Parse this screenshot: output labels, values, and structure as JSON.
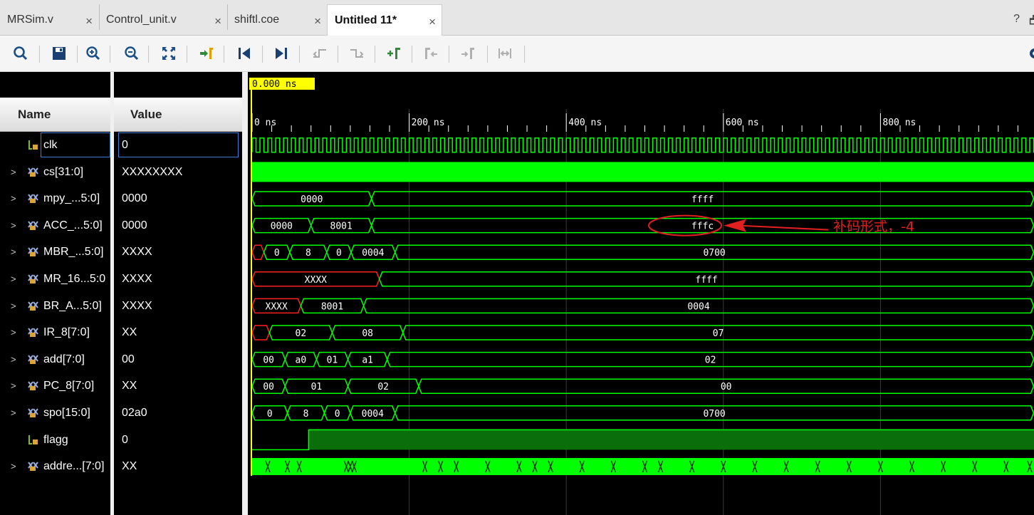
{
  "tabs": [
    {
      "label": "MRSim.v",
      "close": "×"
    },
    {
      "label": "Control_unit.v",
      "close": "×"
    },
    {
      "label": "shiftl.coe",
      "close": "×"
    },
    {
      "label": "Untitled 11*",
      "close": "×"
    }
  ],
  "window_controls": {
    "help": "?",
    "restore": "🗗"
  },
  "toolbar_icons": [
    "search-icon",
    "save-icon",
    "zoom-in-icon",
    "zoom-out-icon",
    "zoom-fit-icon",
    "go-to-cursor-icon",
    "go-to-time-zero-icon",
    "go-to-last-time-icon",
    "previous-transition-icon",
    "next-transition-icon",
    "add-marker-icon",
    "previous-marker-icon",
    "next-marker-icon",
    "swap-cursors-icon",
    "settings-icon"
  ],
  "headers": {
    "name": "Name",
    "value": "Value"
  },
  "cursor_time": "0.000 ns",
  "signals": [
    {
      "name": "clk",
      "value": "0",
      "type": "bit",
      "expandable": false
    },
    {
      "name": "cs[31:0]",
      "value": "XXXXXXXX",
      "type": "bus",
      "expandable": true
    },
    {
      "name": "mpy_...5:0]",
      "value": "0000",
      "type": "bus",
      "expandable": true
    },
    {
      "name": "ACC_...5:0]",
      "value": "0000",
      "type": "bus",
      "expandable": true
    },
    {
      "name": "MBR_...5:0]",
      "value": "XXXX",
      "type": "bus",
      "expandable": true
    },
    {
      "name": "MR_16...5:0",
      "value": "XXXX",
      "type": "bus",
      "expandable": true
    },
    {
      "name": "BR_A...5:0]",
      "value": "XXXX",
      "type": "bus",
      "expandable": true
    },
    {
      "name": "IR_8[7:0]",
      "value": "XX",
      "type": "bus",
      "expandable": true
    },
    {
      "name": "add[7:0]",
      "value": "00",
      "type": "bus",
      "expandable": true
    },
    {
      "name": "PC_8[7:0]",
      "value": "XX",
      "type": "bus",
      "expandable": true
    },
    {
      "name": "spo[15:0]",
      "value": "02a0",
      "type": "bus",
      "expandable": true
    },
    {
      "name": "flagg",
      "value": "0",
      "type": "bit",
      "expandable": false
    },
    {
      "name": "addre...[7:0]",
      "value": "XX",
      "type": "bus",
      "expandable": true
    }
  ],
  "time_axis": {
    "unit": "ns",
    "labels": [
      "0 ns",
      "200 ns",
      "400 ns",
      "600 ns",
      "800 ns"
    ],
    "major_step_ns": 200,
    "ticks_per_major": 8,
    "visible_range_ns": [
      0,
      995
    ]
  },
  "wave_segments": {
    "mpy": [
      {
        "start": 0,
        "end": 152,
        "label": "0000"
      },
      {
        "start": 152,
        "end": 995,
        "label": "ffff"
      }
    ],
    "ACC": [
      {
        "start": 0,
        "end": 75,
        "label": "0000"
      },
      {
        "start": 75,
        "end": 152,
        "label": "8001"
      },
      {
        "start": 152,
        "end": 995,
        "label": "fffc"
      }
    ],
    "MBR": [
      {
        "start": 0,
        "end": 15,
        "label": "",
        "x": true
      },
      {
        "start": 15,
        "end": 48,
        "label": "0"
      },
      {
        "start": 48,
        "end": 95,
        "label": "8"
      },
      {
        "start": 95,
        "end": 126,
        "label": "0"
      },
      {
        "start": 126,
        "end": 182,
        "label": "0004"
      },
      {
        "start": 182,
        "end": 995,
        "label": "0700"
      }
    ],
    "MR": [
      {
        "start": 0,
        "end": 162,
        "label": "XXXX",
        "x": true
      },
      {
        "start": 162,
        "end": 995,
        "label": "ffff"
      }
    ],
    "BR": [
      {
        "start": 0,
        "end": 62,
        "label": "XXXX",
        "x": true
      },
      {
        "start": 62,
        "end": 142,
        "label": "8001"
      },
      {
        "start": 142,
        "end": 995,
        "label": "0004"
      }
    ],
    "IR": [
      {
        "start": 0,
        "end": 22,
        "label": "",
        "x": true
      },
      {
        "start": 22,
        "end": 102,
        "label": "02"
      },
      {
        "start": 102,
        "end": 192,
        "label": "08"
      },
      {
        "start": 192,
        "end": 995,
        "label": "07"
      }
    ],
    "add": [
      {
        "start": 0,
        "end": 42,
        "label": "00"
      },
      {
        "start": 42,
        "end": 82,
        "label": "a0"
      },
      {
        "start": 82,
        "end": 122,
        "label": "01"
      },
      {
        "start": 122,
        "end": 172,
        "label": "a1"
      },
      {
        "start": 172,
        "end": 995,
        "label": "02"
      }
    ],
    "PC": [
      {
        "start": 0,
        "end": 42,
        "label": "00"
      },
      {
        "start": 42,
        "end": 122,
        "label": "01"
      },
      {
        "start": 122,
        "end": 212,
        "label": "02"
      },
      {
        "start": 212,
        "end": 995,
        "label": "00"
      }
    ],
    "spo": [
      {
        "start": 0,
        "end": 45,
        "label": "0"
      },
      {
        "start": 45,
        "end": 92,
        "label": "8"
      },
      {
        "start": 92,
        "end": 125,
        "label": "0"
      },
      {
        "start": 125,
        "end": 182,
        "label": "0004"
      },
      {
        "start": 182,
        "end": 995,
        "label": "0700"
      }
    ]
  },
  "flagg_rise_ns": 72,
  "annotation": {
    "text": "补码形式，-4",
    "color": "#e02020"
  },
  "colors": {
    "wave": "#00ff00",
    "xstate": "#ff2020",
    "grid": "#3a3a3a",
    "cursor": "#ffff00",
    "flagg_fill": "#0a6f0a"
  }
}
